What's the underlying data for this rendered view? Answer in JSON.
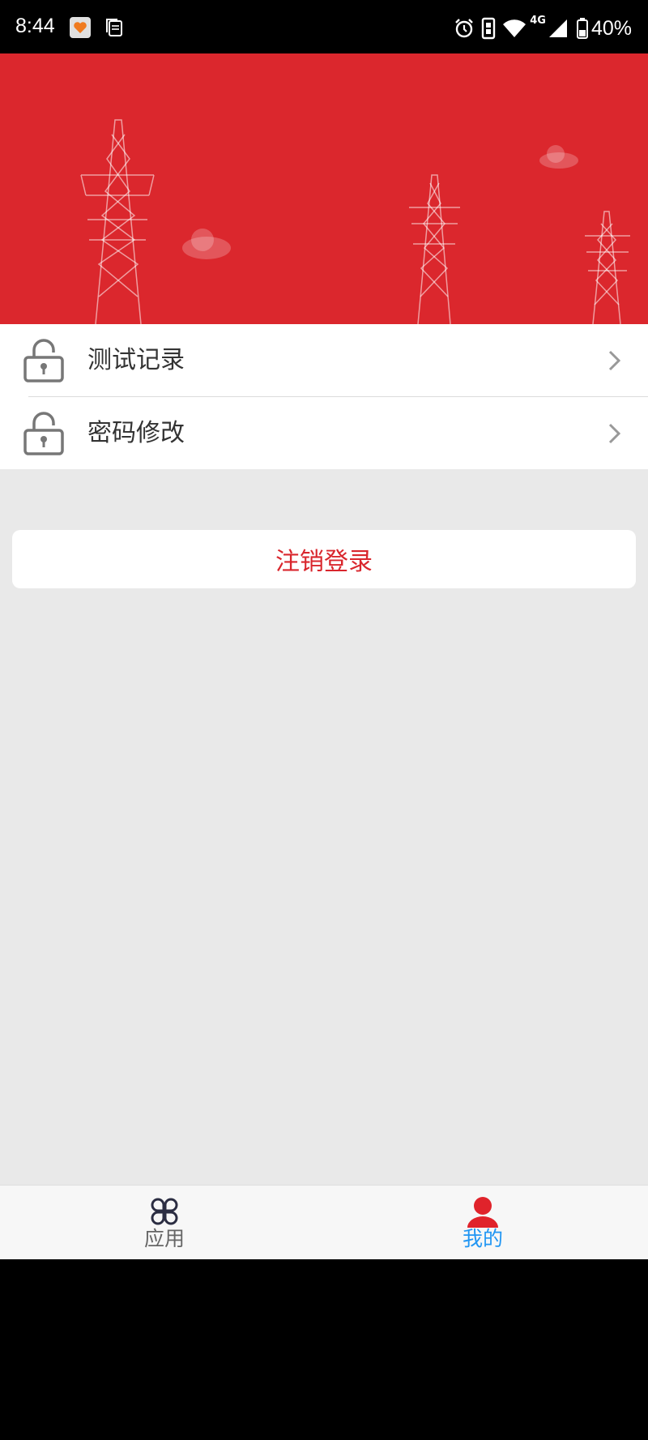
{
  "status_bar": {
    "time": "8:44",
    "battery": "40%",
    "network": "4G",
    "icons": [
      "heart-notification-icon",
      "document-notification-icon",
      "alarm-icon",
      "vibrate-icon",
      "wifi-icon",
      "signal-icon",
      "battery-icon"
    ]
  },
  "menu": {
    "items": [
      {
        "label": "测试记录",
        "icon": "lock-icon"
      },
      {
        "label": "密码修改",
        "icon": "lock-icon"
      }
    ]
  },
  "logout": {
    "label": "注销登录"
  },
  "tabbar": {
    "tabs": [
      {
        "label": "应用",
        "icon": "apps-icon",
        "active": false
      },
      {
        "label": "我的",
        "icon": "profile-icon",
        "active": true
      }
    ]
  },
  "colors": {
    "banner_red": "#db272d",
    "logout_text": "#d9262d",
    "tab_active": "#2196f3",
    "tab_inactive": "#666666",
    "page_bg": "#e9e9e9"
  }
}
